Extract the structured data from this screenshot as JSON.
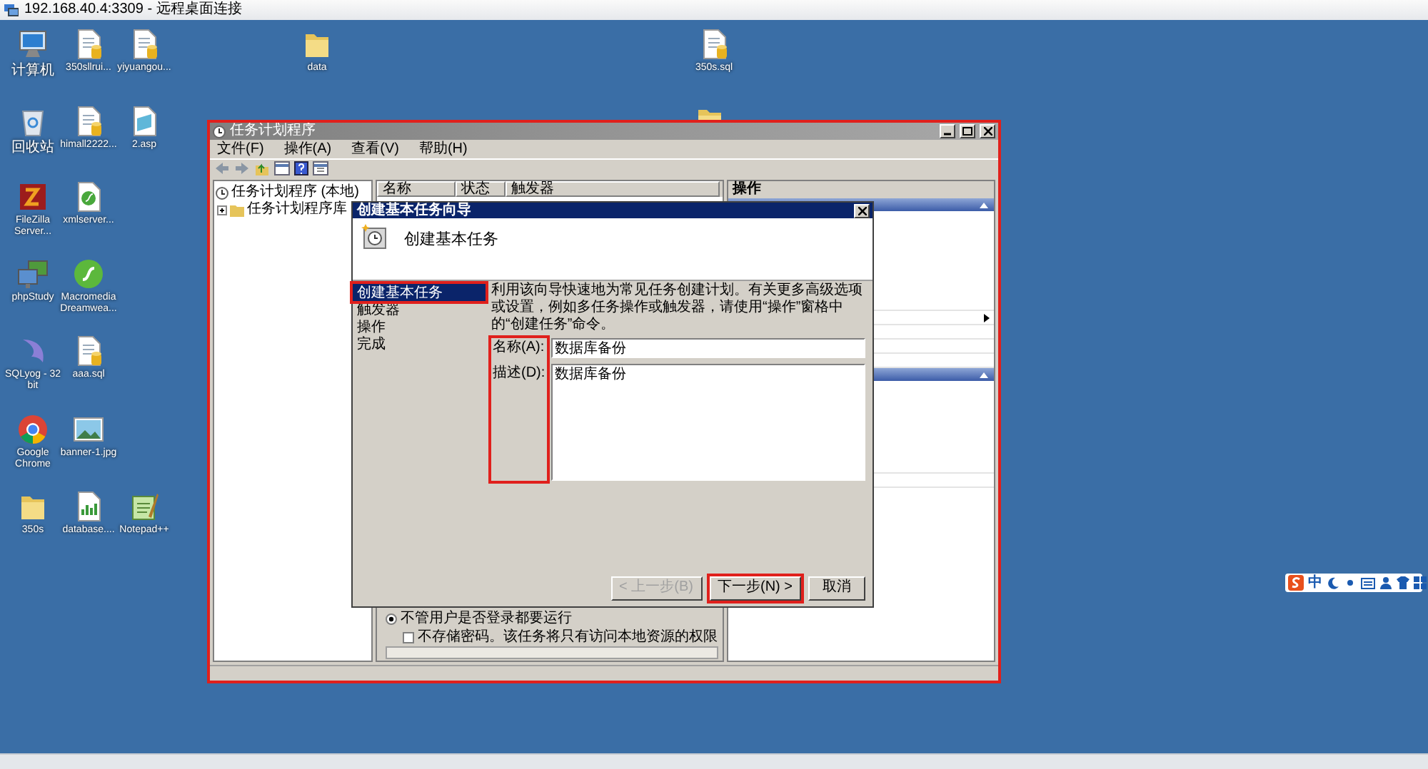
{
  "remote_window": {
    "title": "192.168.40.4:3309 - 远程桌面连接"
  },
  "desktop_icons": [
    {
      "label": "计算机",
      "kind": "computer"
    },
    {
      "label": "350sllrui...",
      "kind": "dbfile"
    },
    {
      "label": "yiyuangou...",
      "kind": "dbfile"
    },
    {
      "label": "data",
      "kind": "folder"
    },
    {
      "label": "350s.sql",
      "kind": "dbfile"
    },
    {
      "kind": "folder"
    },
    {
      "label": "回收站",
      "kind": "bin"
    },
    {
      "label": "himall2222...",
      "kind": "dbfile"
    },
    {
      "label": "2.asp",
      "kind": "page"
    },
    {
      "label": "FileZilla Server...",
      "kind": "zigzag"
    },
    {
      "label": "xmlserver...",
      "kind": "swirlfile"
    },
    {
      "label": "phpStudy",
      "kind": "monitors"
    },
    {
      "label": "Macromedia Dreamwea...",
      "kind": "swirl"
    },
    {
      "label": "SQLyog - 32 bit",
      "kind": "dolphin"
    },
    {
      "label": "aaa.sql",
      "kind": "dbfile"
    },
    {
      "label": "Google Chrome",
      "kind": "browser"
    },
    {
      "label": "banner-1.jpg",
      "kind": "photo"
    },
    {
      "label": "350s",
      "kind": "folder"
    },
    {
      "label": "database....",
      "kind": "chartfile"
    },
    {
      "label": "Notepad++",
      "kind": "notepad"
    }
  ],
  "scheduler": {
    "title": "任务计划程序",
    "highlighted": true,
    "menu": [
      "文件(F)",
      "操作(A)",
      "查看(V)",
      "帮助(H)"
    ],
    "tree": [
      {
        "label": "任务计划程序 (本地)",
        "children": [
          {
            "label": "任务计划程序库",
            "expanded": false
          }
        ]
      }
    ],
    "columns": [
      "名称",
      "状态",
      "触发器"
    ],
    "options": [
      {
        "kind": "radio",
        "label": "不管用户是否登录都要运行",
        "checked": true
      },
      {
        "kind": "checkbox",
        "label": "不存储密码。该任务将只有访问本地资源的权限",
        "checked": false
      }
    ],
    "actions_title": "操作"
  },
  "wizard": {
    "title": "创建基本任务向导",
    "heading": "创建基本任务",
    "steps": [
      {
        "label": "创建基本任务",
        "selected": true,
        "highlighted": true
      },
      {
        "label": "触发器",
        "selected": false,
        "highlighted": false
      },
      {
        "label": "操作",
        "selected": false,
        "highlighted": false
      },
      {
        "label": "完成",
        "selected": false,
        "highlighted": false
      }
    ],
    "description": "利用该向导快速地为常见任务创建计划。有关更多高级选项或设置，例如多任务操作或触发器，请使用“操作”窗格中的“创建任务”命令。",
    "fields": [
      {
        "kind": "text",
        "label": "名称(A):",
        "value": "数据库备份"
      },
      {
        "kind": "textarea",
        "label": "描述(D):",
        "value": "数据库备份"
      }
    ],
    "labels_highlighted": true,
    "buttons": [
      {
        "label": "< 上一步(B)",
        "disabled": true,
        "highlighted": false
      },
      {
        "label": "下一步(N) >",
        "disabled": false,
        "highlighted": true
      },
      {
        "label": "取消",
        "disabled": false,
        "highlighted": false
      }
    ]
  },
  "ime": {
    "mode": "中"
  }
}
